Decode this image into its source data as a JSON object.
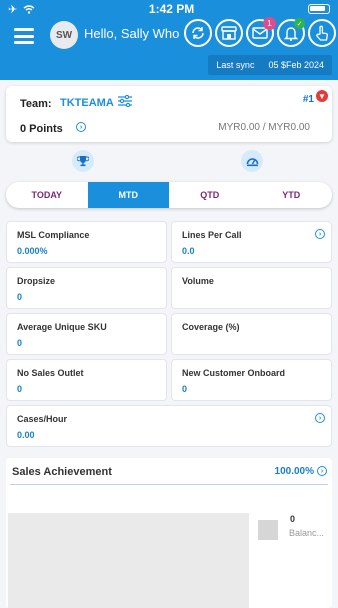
{
  "status": {
    "time": "1:42 PM"
  },
  "header": {
    "avatar_initials": "SW",
    "greeting": "Hello, Sally Who",
    "notification_count": "1",
    "last_sync_label": "Last sync",
    "last_sync_value": "05 $Feb 2024"
  },
  "team": {
    "label": "Team:",
    "value": "TKTEAMA",
    "rank": "#1",
    "points": "0 Points",
    "amount": "MYR0.00 / MYR0.00"
  },
  "tabs": [
    "TODAY",
    "MTD",
    "QTD",
    "YTD"
  ],
  "active_tab": "MTD",
  "kpis": [
    {
      "label": "MSL Compliance",
      "value": "0.000%"
    },
    {
      "label": "Lines Per Call",
      "value": "0.0"
    },
    {
      "label": "Dropsize",
      "value": "0"
    },
    {
      "label": "Volume",
      "value": ""
    },
    {
      "label": "Average Unique SKU",
      "value": "0"
    },
    {
      "label": "Coverage (%)",
      "value": ""
    },
    {
      "label": "No Sales Outlet",
      "value": "0"
    },
    {
      "label": "New Customer Onboard",
      "value": "0"
    },
    {
      "label": "Cases/Hour",
      "value": "0.00"
    }
  ],
  "sales": {
    "title": "Sales Achievement",
    "percent": "100.00%",
    "legend_value": "0",
    "legend_label": "Balanc..."
  },
  "colors": {
    "primary": "#1a8fdc",
    "accent_text": "#7a2b6e",
    "badge": "#e04b8e"
  }
}
